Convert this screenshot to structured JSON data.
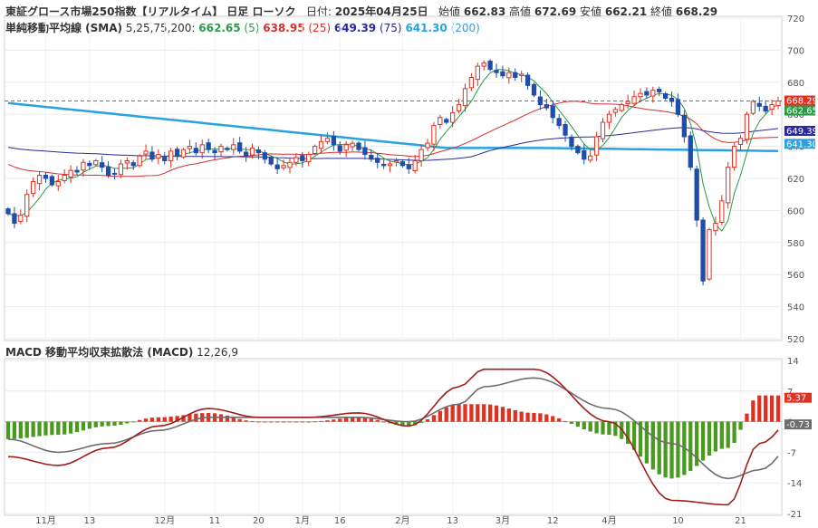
{
  "header": {
    "title": "東証グロース市場250指数【リアルタイム】 日足 ローソク",
    "date_label": "日付:",
    "date": "2025年04月25日",
    "open_label": "始値",
    "open": "662.83",
    "high_label": "高値",
    "high": "672.69",
    "low_label": "安値",
    "low": "662.21",
    "close_label": "終値",
    "close": "668.29",
    "sma_title": "単純移動平均線 (SMA)",
    "sma_params": "5,25,75,200:",
    "sma5_val": "662.65",
    "sma5_p": "(5)",
    "sma25_val": "638.95",
    "sma25_p": "(25)",
    "sma75_val": "649.39",
    "sma75_p": "(75)",
    "sma200_val": "641.30",
    "sma200_p": "(200)",
    "macd_title": "MACD 移動平均収束拡散法 (MACD)",
    "macd_params": "12,26,9"
  },
  "colors": {
    "up": "#e03020",
    "down": "#1f4ea8",
    "sma5": "#2a9a48",
    "sma25": "#d63030",
    "sma75": "#2a2a9a",
    "sma200": "#29a3e0",
    "macd_line": "#a11d1d",
    "signal_line": "#6e6e6e",
    "hist_pos": "#e03020",
    "hist_neg": "#4a9a1f",
    "close_tag": "#e03020",
    "sma5_tag": "#2a9a48",
    "sma75_tag": "#2a2a9a",
    "sma200_tag": "#29a3e0"
  },
  "chart_data": [
    {
      "type": "candlestick",
      "title": "東証グロース市場250指数【リアルタイム】 日足 ローソク",
      "y_ticks": [
        "720",
        "700",
        "680",
        "660",
        "640",
        "620",
        "600",
        "580",
        "560",
        "540",
        "520"
      ],
      "ylim": [
        520,
        720
      ],
      "x_ticks": [
        "11月",
        "13",
        "12月",
        "11",
        "20",
        "1月",
        "16",
        "2月",
        "13",
        "3月",
        "12",
        "4月",
        "10",
        "21"
      ],
      "last_close_line": 668.29,
      "tags": [
        {
          "name": "close",
          "value": 668.29,
          "label": "668.29"
        },
        {
          "name": "sma5",
          "value": 662.65,
          "label": "662.65"
        },
        {
          "name": "sma75",
          "value": 649.39,
          "label": "649.39"
        },
        {
          "name": "sma200",
          "value": 641.3,
          "label": "641.30"
        }
      ],
      "close_series": [
        598,
        592,
        597,
        610,
        618,
        622,
        620,
        616,
        618,
        622,
        625,
        624,
        630,
        628,
        631,
        627,
        622,
        623,
        629,
        631,
        628,
        634,
        637,
        632,
        635,
        631,
        637,
        634,
        638,
        640,
        636,
        641,
        638,
        636,
        640,
        638,
        641,
        637,
        634,
        639,
        636,
        632,
        629,
        626,
        628,
        630,
        633,
        631,
        635,
        640,
        643,
        645,
        641,
        637,
        641,
        642,
        638,
        635,
        632,
        630,
        628,
        629,
        631,
        628,
        626,
        631,
        638,
        642,
        653,
        658,
        655,
        661,
        666,
        676,
        683,
        690,
        692,
        688,
        686,
        684,
        686,
        683,
        685,
        678,
        672,
        666,
        664,
        658,
        653,
        647,
        640,
        636,
        632,
        634,
        646,
        655,
        660,
        663,
        666,
        668,
        671,
        673,
        672,
        675,
        674,
        670,
        668,
        660,
        646,
        627,
        594,
        556,
        588,
        592,
        606,
        627,
        640,
        645,
        660,
        668,
        665,
        662,
        666,
        668.29
      ],
      "series": [
        {
          "name": "SMA(5)",
          "value": 662.65
        },
        {
          "name": "SMA(25)",
          "value": 638.95
        },
        {
          "name": "SMA(75)",
          "value": 649.39
        },
        {
          "name": "SMA(200)",
          "value": 641.3
        }
      ]
    },
    {
      "type": "macd",
      "title": "MACD 移動平均収束拡散法 (MACD)",
      "params": "12,26,9",
      "y_ticks": [
        "14",
        "7",
        "0",
        "-7",
        "-14",
        "-21"
      ],
      "ylim": [
        -21,
        14
      ],
      "tags": [
        {
          "name": "histogram",
          "value": 5.37,
          "label": "5.37"
        },
        {
          "name": "signal",
          "value": -0.73,
          "label": "-0.73"
        }
      ],
      "series": [
        {
          "name": "MACD",
          "x": [
            0,
            8,
            16,
            24,
            32,
            40,
            48,
            56,
            64,
            72,
            76,
            84,
            96,
            106,
            115,
            120,
            128
          ],
          "values": [
            -8,
            -10,
            -6,
            -1,
            3,
            1,
            1,
            2,
            -1,
            8,
            12,
            12,
            0,
            -18,
            -19,
            -5,
            5
          ]
        },
        {
          "name": "Signal",
          "x": [
            0,
            8,
            16,
            24,
            32,
            40,
            48,
            56,
            64,
            72,
            76,
            84,
            96,
            106,
            115,
            120,
            128
          ],
          "values": [
            -4,
            -7,
            -5,
            -2,
            1,
            1,
            1,
            1,
            0,
            4,
            8,
            10,
            3,
            -5,
            -13,
            -11,
            -1
          ]
        }
      ]
    }
  ]
}
